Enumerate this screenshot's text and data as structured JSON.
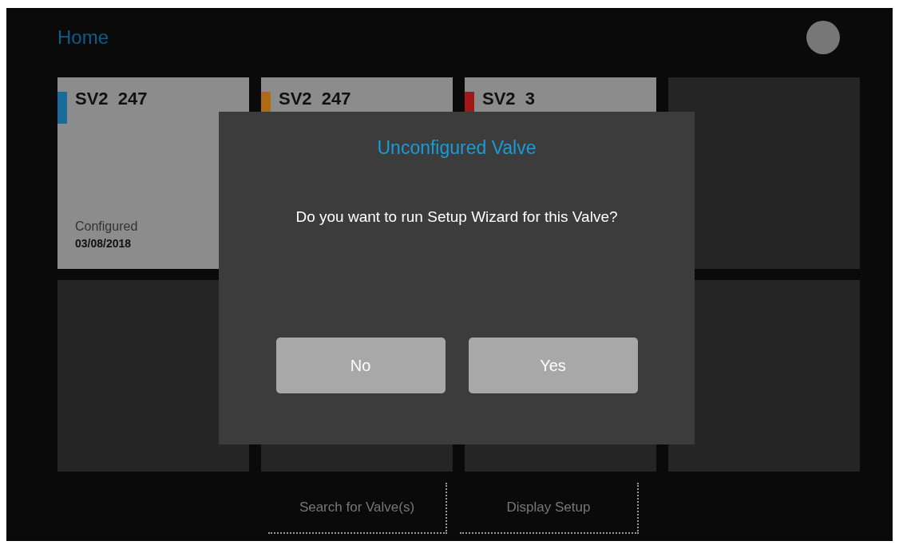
{
  "header": {
    "title": "Home"
  },
  "tiles": [
    {
      "kind": "valve",
      "name": "SV2  247",
      "color": "#1a6a9a",
      "status": "Configured",
      "date": "03/08/2018"
    },
    {
      "kind": "valve",
      "name": "SV2  247",
      "color": "#b06a10"
    },
    {
      "kind": "valve",
      "name": "SV2  3",
      "color": "#a01818"
    },
    {
      "kind": "empty"
    },
    {
      "kind": "empty"
    },
    {
      "kind": "empty"
    },
    {
      "kind": "empty"
    },
    {
      "kind": "empty"
    }
  ],
  "footer_buttons": [
    "Search for Valve(s)",
    "Display Setup"
  ],
  "dialog": {
    "title": "Unconfigured Valve",
    "message": "Do you want to run Setup Wizard for this Valve?",
    "buttons": [
      "No",
      "Yes"
    ]
  }
}
